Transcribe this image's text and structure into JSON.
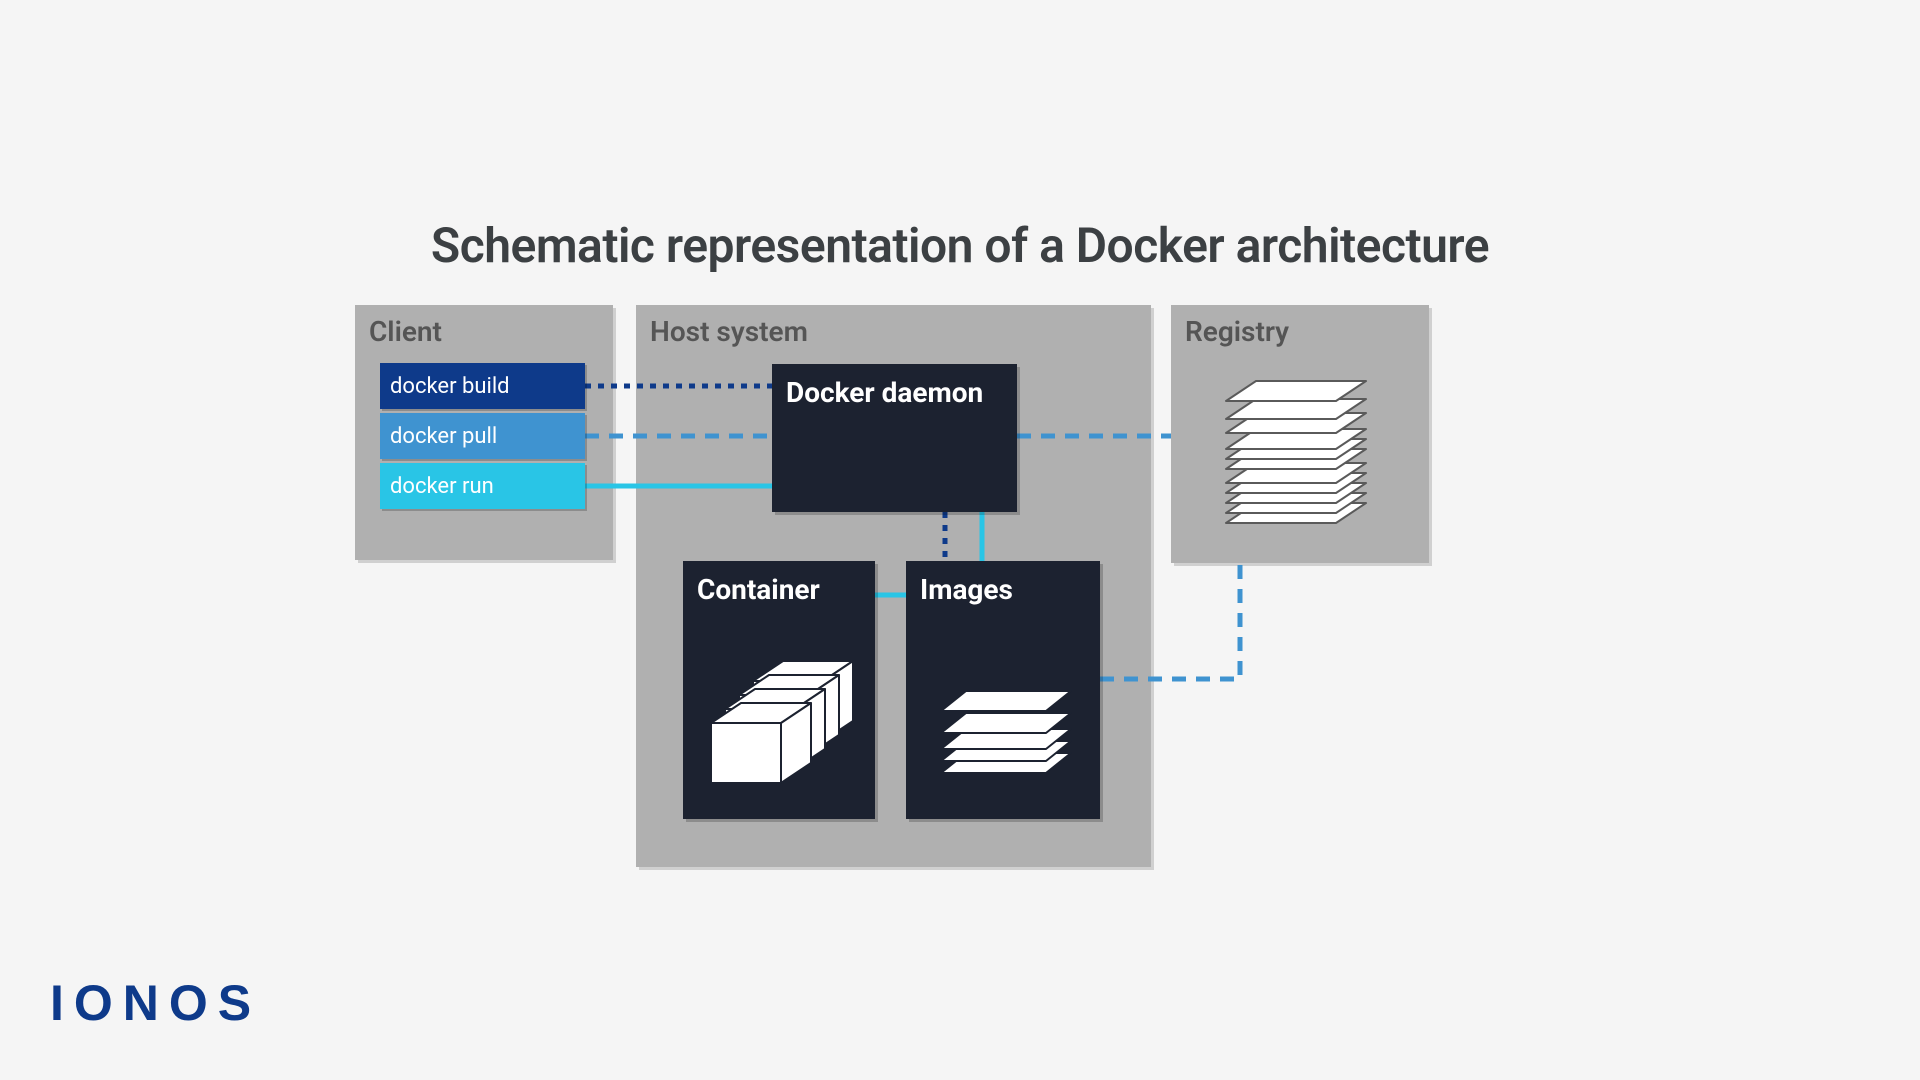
{
  "title": "Schematic representation of a Docker architecture",
  "panels": {
    "client": "Client",
    "host": "Host system",
    "registry": "Registry"
  },
  "commands": {
    "build": "docker build",
    "pull": "docker pull",
    "run": "docker run"
  },
  "blocks": {
    "daemon": "Docker daemon",
    "container": "Container",
    "images": "Images"
  },
  "logo": "IONOS",
  "colors": {
    "build": "#0e3a8a",
    "pull": "#3f93d0",
    "run": "#29c5e6",
    "block": "#1c2230",
    "panel": "#b0b0b0"
  }
}
